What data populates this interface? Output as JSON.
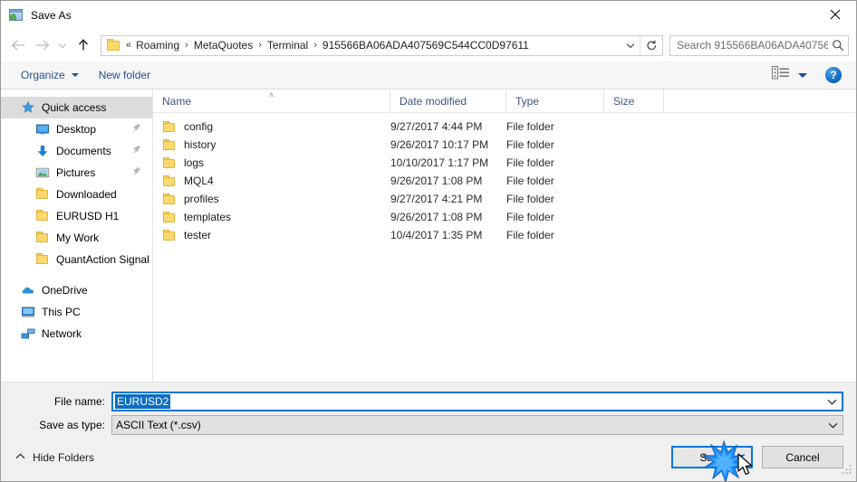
{
  "window": {
    "title": "Save As",
    "app_icon": "metatrader-save-icon",
    "close_label": "✕"
  },
  "nav": {
    "back_icon": "arrow-left-icon",
    "forward_icon": "arrow-right-icon",
    "recent_icon": "chevron-down-icon",
    "up_icon": "arrow-up-icon",
    "address": {
      "folder_icon": "folder-icon",
      "overflow": "«",
      "crumbs": [
        "Roaming",
        "MetaQuotes",
        "Terminal",
        "915566BA06ADA407569C544CC0D97611"
      ],
      "separator": "›",
      "dropdown_icon": "chevron-down-icon",
      "refresh_icon": "refresh-icon"
    },
    "search": {
      "placeholder": "Search 915566BA06ADA40756...",
      "icon": "search-icon"
    }
  },
  "toolbar": {
    "organize_label": "Organize",
    "new_folder_label": "New folder",
    "view_icon": "view-options-icon",
    "help_label": "?"
  },
  "sidebar": {
    "items": [
      {
        "label": "Quick access",
        "icon": "star-icon",
        "level": "root",
        "selected": true,
        "pinned": false
      },
      {
        "label": "Desktop",
        "icon": "desktop-icon",
        "level": "child",
        "selected": false,
        "pinned": true
      },
      {
        "label": "Documents",
        "icon": "download-arrow-icon",
        "level": "child",
        "selected": false,
        "pinned": true
      },
      {
        "label": "Pictures",
        "icon": "pictures-icon",
        "level": "child",
        "selected": false,
        "pinned": true
      },
      {
        "label": "Downloaded",
        "icon": "folder-icon",
        "level": "child",
        "selected": false,
        "pinned": false
      },
      {
        "label": "EURUSD H1",
        "icon": "folder-icon",
        "level": "child",
        "selected": false,
        "pinned": false
      },
      {
        "label": "My Work",
        "icon": "folder-icon",
        "level": "child",
        "selected": false,
        "pinned": false
      },
      {
        "label": "QuantAction Signal",
        "icon": "folder-icon",
        "level": "child",
        "selected": false,
        "pinned": false
      },
      {
        "label": "OneDrive",
        "icon": "cloud-icon",
        "level": "root",
        "selected": false,
        "pinned": false
      },
      {
        "label": "This PC",
        "icon": "computer-icon",
        "level": "root",
        "selected": false,
        "pinned": false
      },
      {
        "label": "Network",
        "icon": "network-icon",
        "level": "root",
        "selected": false,
        "pinned": false
      }
    ]
  },
  "filelist": {
    "columns": [
      "Name",
      "Date modified",
      "Type",
      "Size"
    ],
    "sort_caret": "˄",
    "rows": [
      {
        "name": "config",
        "date": "9/27/2017 4:44 PM",
        "type": "File folder",
        "size": ""
      },
      {
        "name": "history",
        "date": "9/26/2017 10:17 PM",
        "type": "File folder",
        "size": ""
      },
      {
        "name": "logs",
        "date": "10/10/2017 1:17 PM",
        "type": "File folder",
        "size": ""
      },
      {
        "name": "MQL4",
        "date": "9/26/2017 1:08 PM",
        "type": "File folder",
        "size": ""
      },
      {
        "name": "profiles",
        "date": "9/27/2017 4:21 PM",
        "type": "File folder",
        "size": ""
      },
      {
        "name": "templates",
        "date": "9/26/2017 1:08 PM",
        "type": "File folder",
        "size": ""
      },
      {
        "name": "tester",
        "date": "10/4/2017 1:35 PM",
        "type": "File folder",
        "size": ""
      }
    ]
  },
  "form": {
    "filename_label": "File name:",
    "filename_value": "EURUSD2",
    "filetype_label": "Save as type:",
    "filetype_value": "ASCII Text (*.csv)",
    "dropdown_icon": "chevron-down-icon"
  },
  "footer": {
    "hide_folders_label": "Hide Folders",
    "hide_folders_icon": "chevron-up-icon",
    "save_label": "Save",
    "cancel_label": "Cancel",
    "resize_grip_icon": "resize-grip-icon"
  },
  "pointer": {
    "click_effect": "click-burst",
    "cursor_icon": "mouse-cursor-icon"
  },
  "colors": {
    "accent": "#0078d7",
    "selection": "#0b6ec6",
    "folder": "#fcd96e",
    "link": "#24508f"
  }
}
